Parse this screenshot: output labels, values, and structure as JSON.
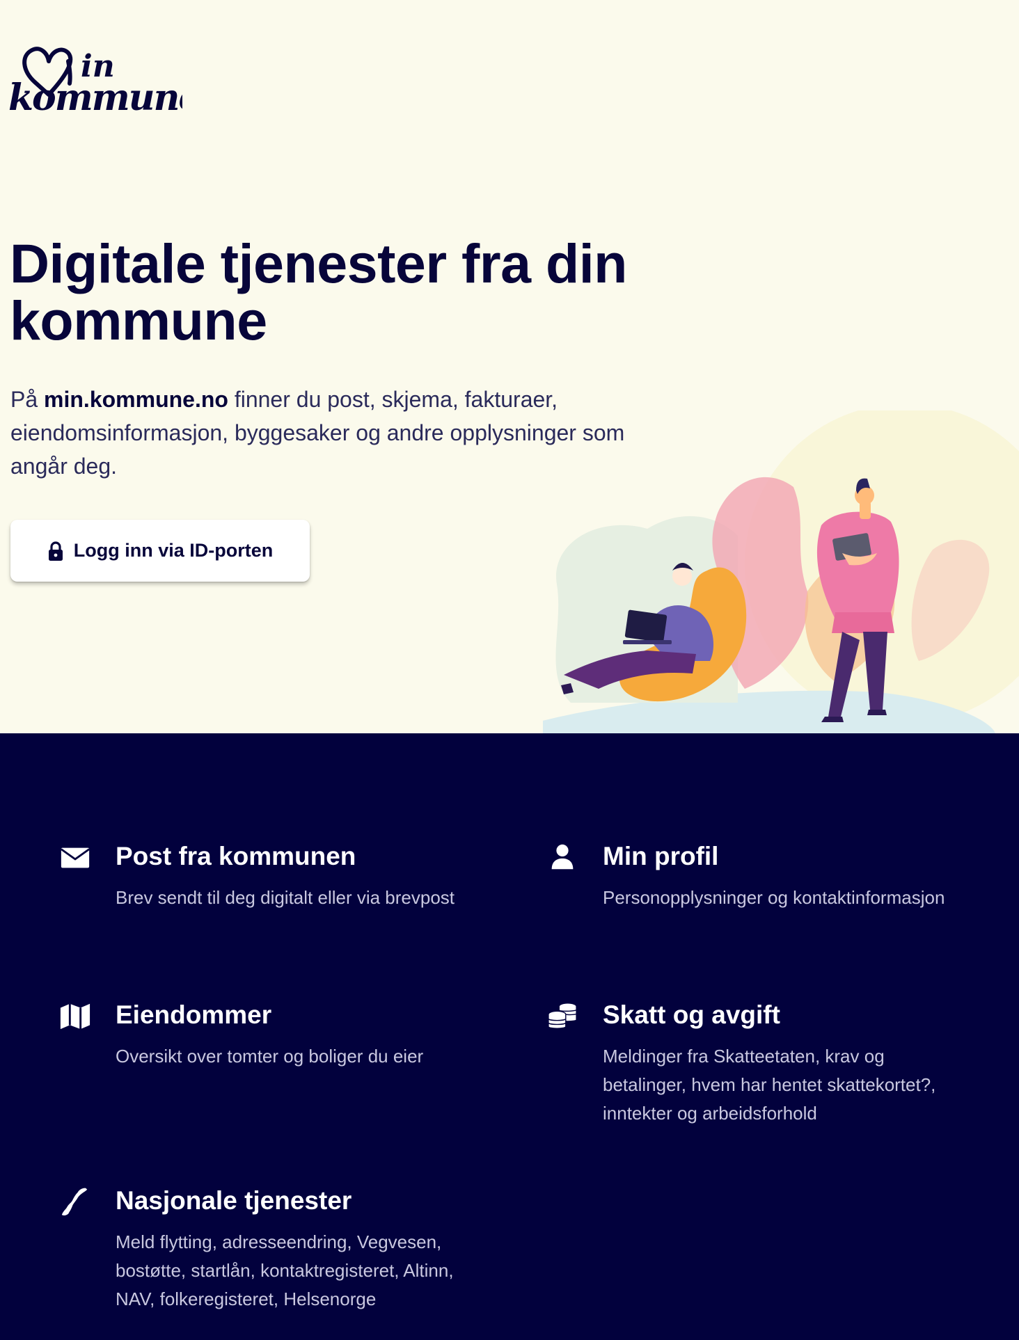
{
  "logo": {
    "text_line1": "Min",
    "text_line2": "kommune"
  },
  "hero": {
    "title": "Digitale tjenester fra din kommune",
    "desc_prefix": "På ",
    "desc_site": "min.kommune.no",
    "desc_suffix": " finner du post, skjema, fakturaer, eiendomsinformasjon, byggesaker og andre opplysninger som angår deg.",
    "login_label": "Logg inn via ID-porten"
  },
  "features": [
    {
      "icon": "envelope-icon",
      "title": "Post fra kommunen",
      "desc": "Brev sendt til deg digitalt eller via brevpost"
    },
    {
      "icon": "user-icon",
      "title": "Min profil",
      "desc": "Personopplysninger og kontaktinformasjon"
    },
    {
      "icon": "map-icon",
      "title": "Eiendommer",
      "desc": "Oversikt over tomter og boliger du eier"
    },
    {
      "icon": "coins-icon",
      "title": "Skatt og avgift",
      "desc": "Meldinger fra Skatteetaten, krav og betalinger, hvem har hentet skattekortet?, inntekter og arbeidsforhold"
    },
    {
      "icon": "norway-map-icon",
      "title": "Nasjonale tjenester",
      "desc": "Meld flytting, adresseendring, Vegvesen, bostøtte, startlån, kontaktregisteret, Altinn, NAV, folkeregisteret, Helsenorge"
    }
  ],
  "colors": {
    "hero_bg": "#fbfaec",
    "navy": "#02013d",
    "text_dark": "#07053a",
    "text_muted": "#c9c8e0"
  }
}
